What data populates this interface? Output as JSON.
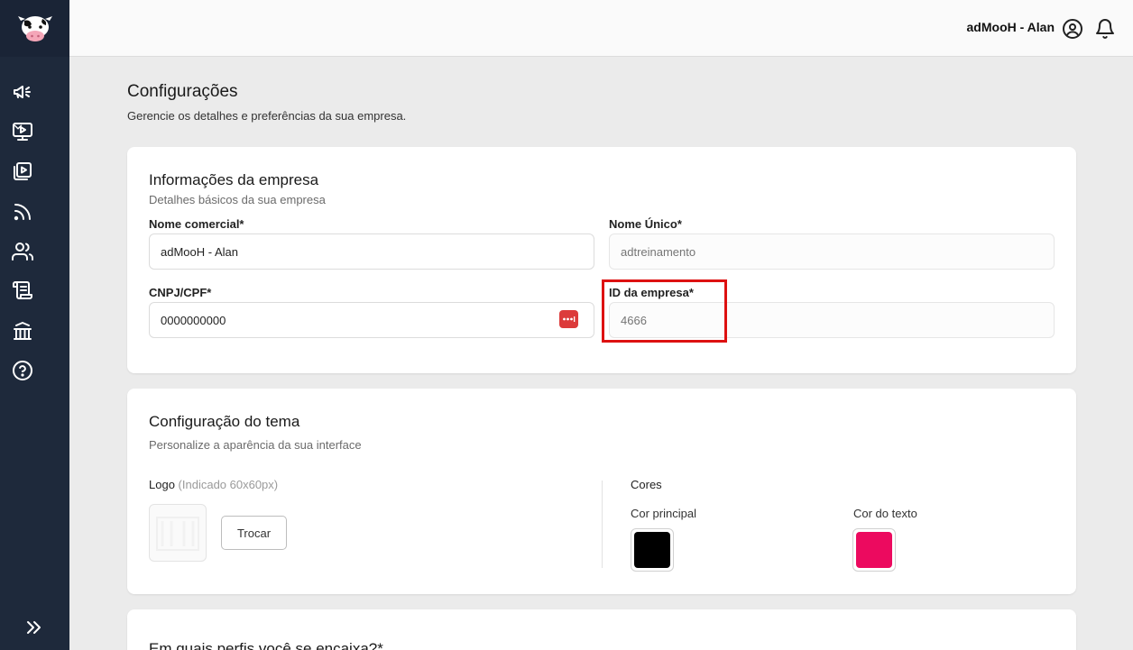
{
  "topbar": {
    "user_name": "adMooH - Alan"
  },
  "sidebar": {
    "items": [
      {
        "icon": "megaphone-icon"
      },
      {
        "icon": "monitor-play-icon",
        "has_submenu": true
      },
      {
        "icon": "video-library-icon"
      },
      {
        "icon": "rss-feed-icon"
      },
      {
        "icon": "users-icon"
      },
      {
        "icon": "scroll-icon"
      },
      {
        "icon": "bank-icon"
      },
      {
        "icon": "help-icon"
      }
    ],
    "expand_icon": "double-chevron-right-icon"
  },
  "page": {
    "title": "Configurações",
    "subtitle": "Gerencie os detalhes e preferências da sua empresa."
  },
  "company_info": {
    "title": "Informações da empresa",
    "subtitle": "Detalhes básicos da sua empresa",
    "trade_name_label": "Nome comercial*",
    "trade_name_value": "adMooH - Alan",
    "unique_name_label": "Nome Único*",
    "unique_name_placeholder": "adtreinamento",
    "cnpj_label": "CNPJ/CPF*",
    "cnpj_value": "0000000000",
    "company_id_label": "ID da empresa*",
    "company_id_placeholder": "4666"
  },
  "theme": {
    "title": "Configuração do tema",
    "subtitle": "Personalize a aparência da sua interface",
    "logo_label": "Logo",
    "logo_hint": "(Indicado 60x60px)",
    "swap_button": "Trocar",
    "colors_heading": "Cores",
    "primary_color_label": "Cor principal",
    "primary_color": "#000000",
    "text_color_label": "Cor do texto",
    "text_color": "#ec0a5f"
  },
  "profiles": {
    "title": "Em quais perfis você se encaixa?*"
  },
  "colors": {
    "sidebar_bg": "#1e293b",
    "highlight": "#dd1111",
    "password_manager": "#dc3b3b"
  }
}
